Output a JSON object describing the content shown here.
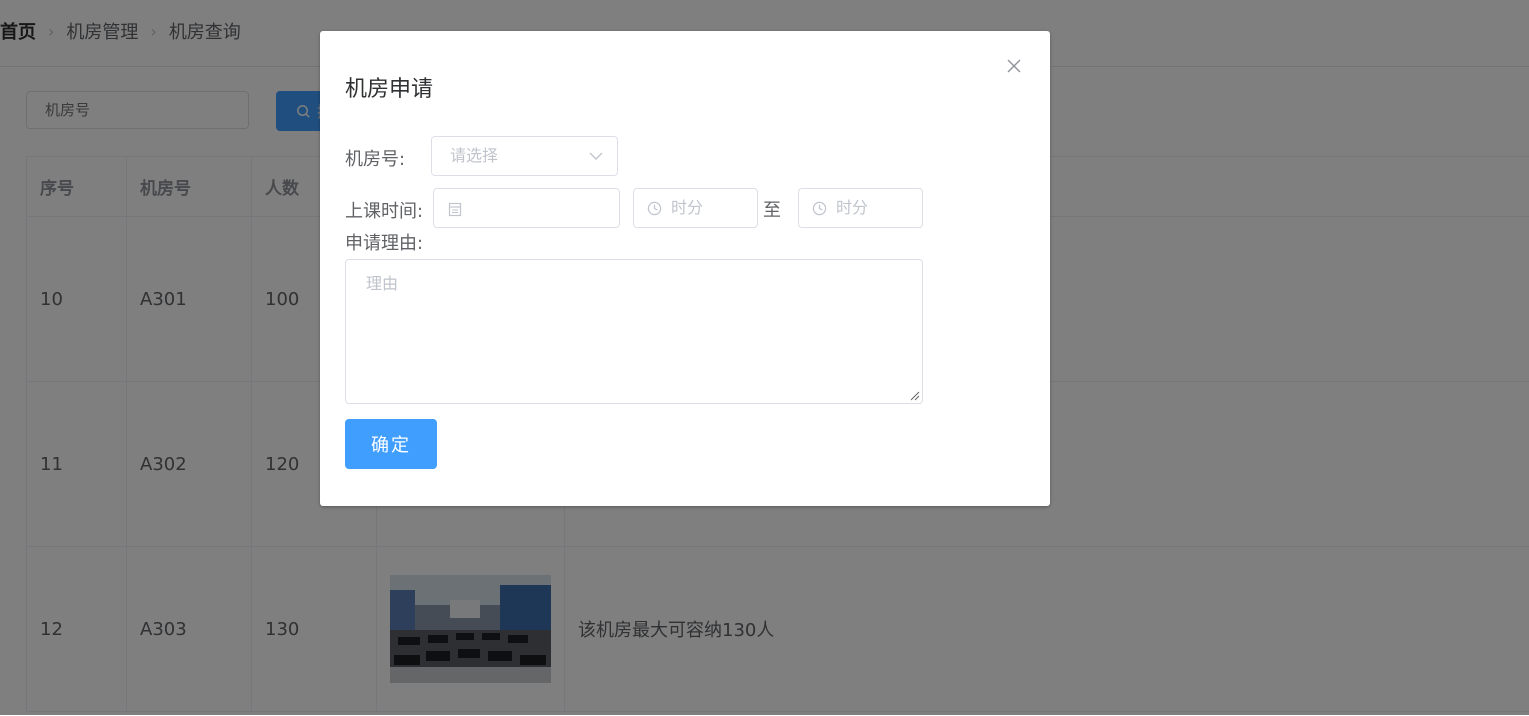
{
  "breadcrumb": {
    "items": [
      "首页",
      "机房管理",
      "机房查询"
    ]
  },
  "search": {
    "placeholder": "机房号",
    "button_label": "搜"
  },
  "table": {
    "headers": [
      "序号",
      "机房号",
      "人数",
      "",
      ""
    ],
    "rows": [
      {
        "id": "10",
        "room": "A301",
        "capacity": "100",
        "description": ""
      },
      {
        "id": "11",
        "room": "A302",
        "capacity": "120",
        "description": ""
      },
      {
        "id": "12",
        "room": "A303",
        "capacity": "130",
        "description": "该机房最大可容纳130人"
      }
    ]
  },
  "dialog": {
    "title": "机房申请",
    "room_label": "机房号:",
    "room_placeholder": "请选择",
    "time_label": "上课时间:",
    "time_start_placeholder": "时分",
    "range_separator": "至",
    "time_end_placeholder": "时分",
    "reason_label": "申请理由:",
    "reason_placeholder": "理由",
    "confirm_label": "确定"
  },
  "colors": {
    "primary": "#409eff",
    "overlay": "rgba(0,0,0,0.5)"
  },
  "icons": [
    "search-icon",
    "close-icon",
    "chevron-down-icon",
    "calendar-icon",
    "clock-icon"
  ]
}
